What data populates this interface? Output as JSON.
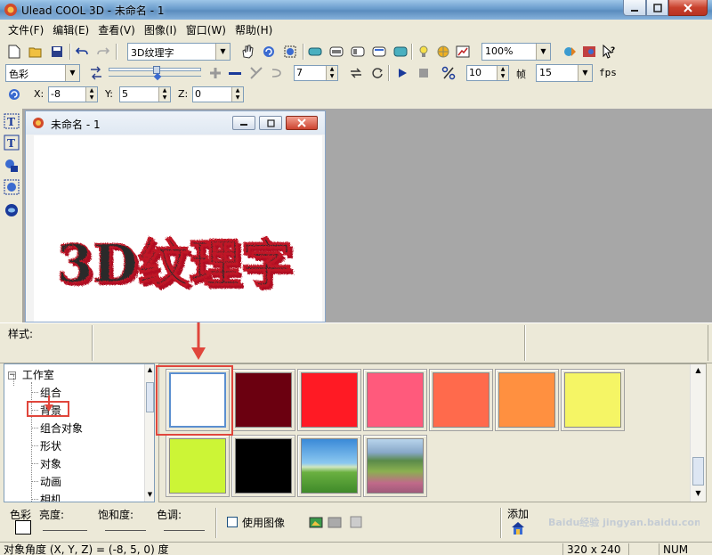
{
  "window": {
    "title": "Ulead COOL 3D - 未命名 - 1"
  },
  "menu": [
    "文件(F)",
    "编辑(E)",
    "查看(V)",
    "图像(I)",
    "窗口(W)",
    "帮助(H)"
  ],
  "toolbar1": {
    "text_style_combo": "3D纹理字",
    "zoom_combo": "100%"
  },
  "toolbar2": {
    "attribute_combo": "色彩",
    "frame_value": "7",
    "frames_value": "10",
    "frames_label": "帧",
    "fps_value": "15",
    "fps_label": "fps"
  },
  "toolbar3": {
    "x_label": "X:",
    "x_value": "-8",
    "y_label": "Y:",
    "y_value": "5",
    "z_label": "Z:",
    "z_value": "0"
  },
  "document": {
    "title": "未命名 - 1",
    "text_art": "3D纹理字"
  },
  "style_strip": {
    "label": "样式:"
  },
  "tree": {
    "root": "工作室",
    "items": [
      "组合",
      "背景",
      "组合对象",
      "形状",
      "对象",
      "动画",
      "相机"
    ],
    "selected_index": 1
  },
  "swatches": [
    {
      "kind": "color",
      "color": "#ffffff",
      "selected": true
    },
    {
      "kind": "color",
      "color": "#6b0010"
    },
    {
      "kind": "color",
      "color": "#ff1a24"
    },
    {
      "kind": "color",
      "color": "#ff5a7c"
    },
    {
      "kind": "color",
      "color": "#ff6a4c"
    },
    {
      "kind": "color",
      "color": "#ff9040"
    },
    {
      "kind": "color",
      "color": "#f5f565"
    },
    {
      "kind": "color",
      "color": "#ccf536"
    },
    {
      "kind": "color",
      "color": "#000000"
    },
    {
      "kind": "image",
      "theme": "green meadow under blue sky"
    },
    {
      "kind": "image",
      "theme": "hills with flower field"
    }
  ],
  "bottom": {
    "color_label": "色彩",
    "brightness_label": "亮度:",
    "saturation_label": "饱和度:",
    "hue_label": "色调:",
    "use_image_label": "使用图像",
    "add_label": "添加"
  },
  "status": {
    "message": "对象角度 (X, Y, Z) = (-8, 5, 0) 度",
    "size": "320 x 240",
    "num": "NUM"
  },
  "watermark": "Baidu经验 jingyan.baidu.com",
  "colors": {
    "accent_red": "#e0463c",
    "workspace_gray": "#a7a7a7",
    "dialog_bg": "#ece9d8"
  }
}
